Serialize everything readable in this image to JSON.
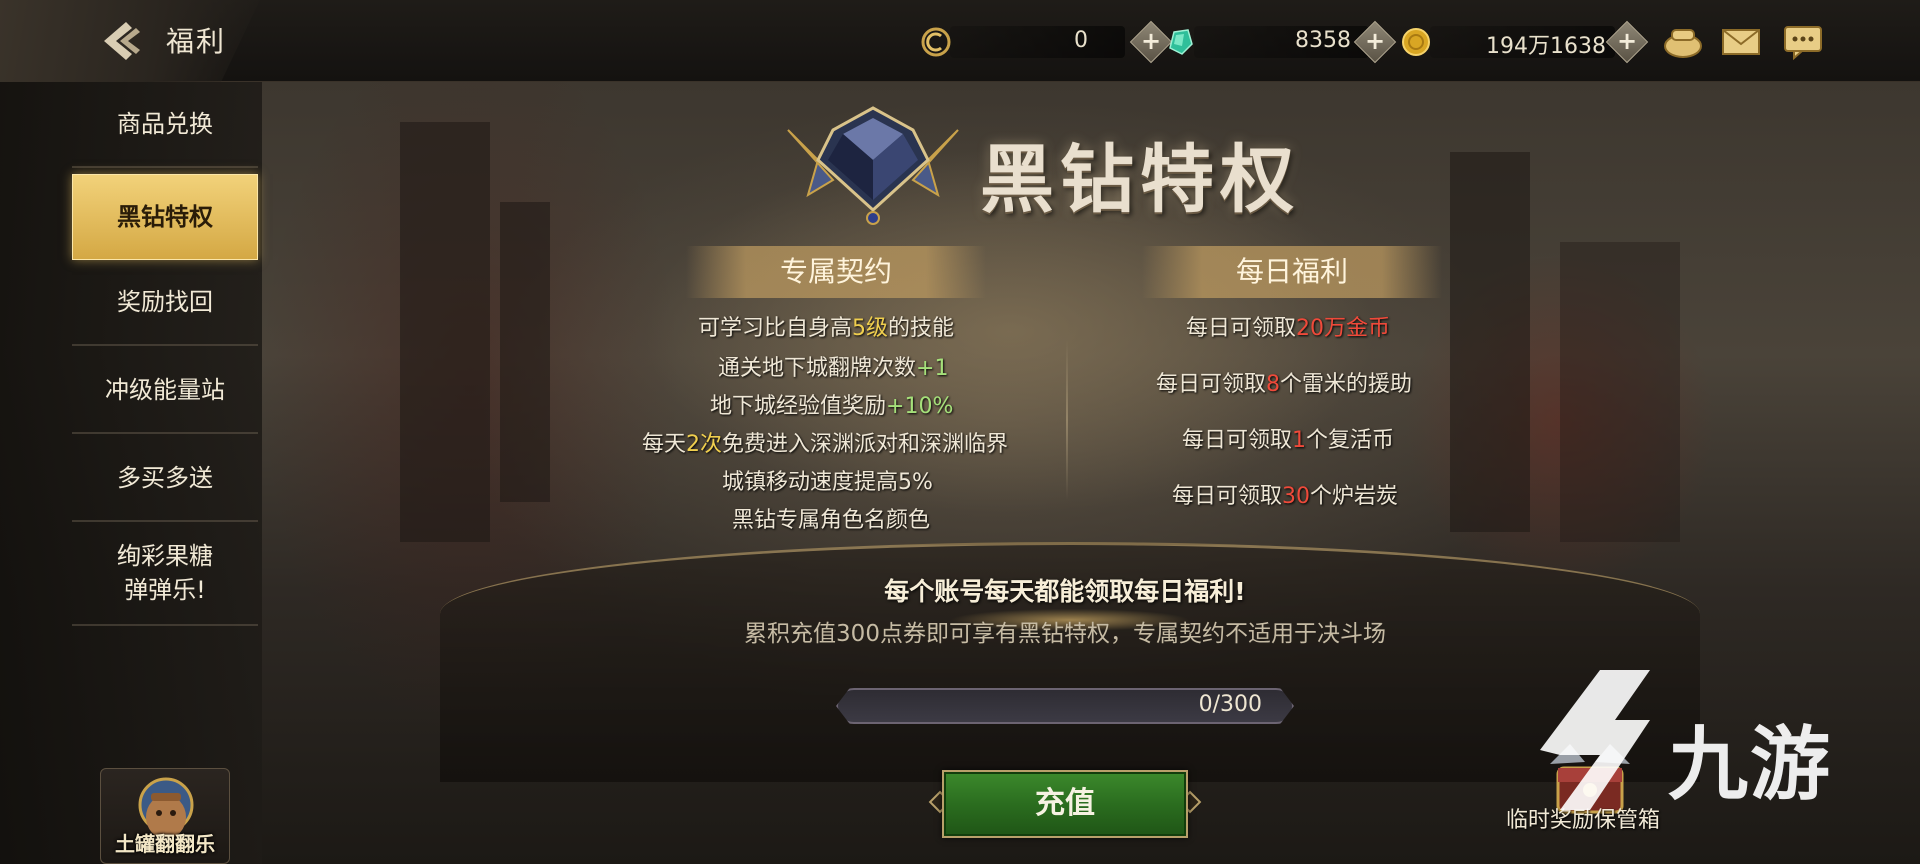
{
  "header": {
    "title": "福利",
    "currencies": [
      {
        "icon": "crest-coin-icon",
        "value": "0"
      },
      {
        "icon": "green-crystal-icon",
        "value": "8358"
      },
      {
        "icon": "gold-coin-icon",
        "value": "194万1638"
      }
    ],
    "icons": [
      "purse-icon",
      "mail-icon",
      "chat-icon"
    ]
  },
  "sidebar": {
    "items": [
      {
        "label": "商品兑换",
        "active": false
      },
      {
        "label": "黑钻特权",
        "active": true
      },
      {
        "label": "奖励找回",
        "active": false
      },
      {
        "label": "冲级能量站",
        "active": false
      },
      {
        "label": "多买多送",
        "active": false
      },
      {
        "label": "绚彩果糖\n弹弹乐!",
        "active": false
      }
    ],
    "jar_label": "土罐翻翻乐"
  },
  "main": {
    "hero_title": "黑钻特权",
    "contract": {
      "title": "专属契约",
      "items": [
        {
          "pre": "可学习比自身高",
          "hl": "5级",
          "post": "的技能"
        },
        {
          "pre": "通关地下城翻牌次数",
          "hl": "+1",
          "post": ""
        },
        {
          "pre": "地下城经验值奖励",
          "hl": "+10%",
          "post": ""
        },
        {
          "pre": "每天",
          "hl": "2次",
          "post": "免费进入深渊派对和深渊临界"
        },
        {
          "pre": "城镇移动速度提高5%",
          "hl": "",
          "post": ""
        },
        {
          "pre": "黑钻专属角色名颜色",
          "hl": "",
          "post": ""
        }
      ]
    },
    "daily": {
      "title": "每日福利",
      "items": [
        {
          "pre": "每日可领取",
          "hl": "20万金币",
          "post": ""
        },
        {
          "pre": "每日可领取",
          "hl": "8",
          "post": "个雷米的援助"
        },
        {
          "pre": "每日可领取",
          "hl": "1",
          "post": "个复活币"
        },
        {
          "pre": "每日可领取",
          "hl": "30",
          "post": "个炉岩炭"
        }
      ]
    },
    "notice_main": "每个账号每天都能领取每日福利!",
    "notice_sub": "累积充值300点券即可享有黑钻特权，专属契约不适用于决斗场",
    "progress": {
      "text": "0/300",
      "fraction": 0
    },
    "recharge_label": "充值",
    "storage_label": "临时奖励保管箱"
  },
  "watermark": {
    "text": "九游"
  },
  "colors": {
    "highlight": "#f0cf4e",
    "red": "#ef4a3a",
    "green_bonus": "#a5e07a",
    "active_tab": "#e6bd5c",
    "recharge": "#2b6d1f"
  }
}
